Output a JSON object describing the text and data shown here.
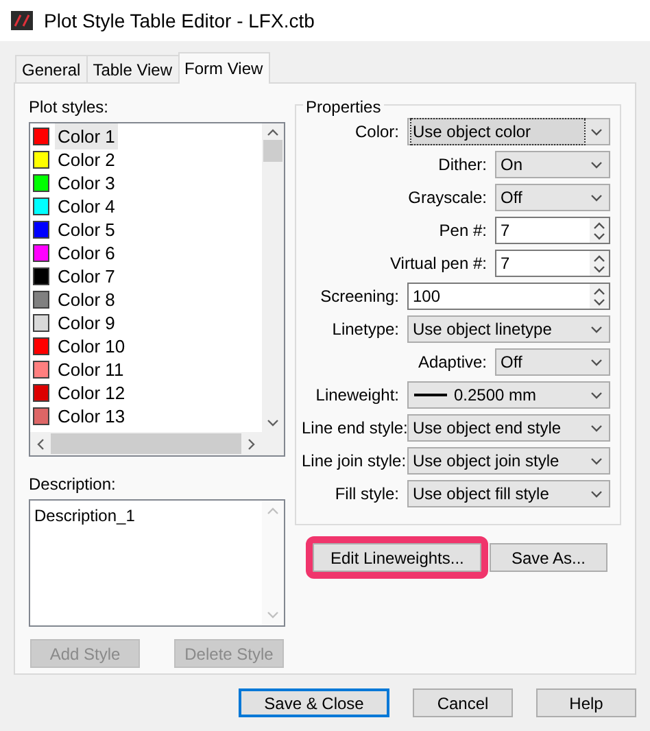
{
  "window": {
    "title": "Plot Style Table Editor - LFX.ctb"
  },
  "tabs": [
    {
      "label": "General",
      "selected": false
    },
    {
      "label": "Table View",
      "selected": false
    },
    {
      "label": "Form View",
      "selected": true
    }
  ],
  "plot_styles": {
    "label": "Plot styles:",
    "items": [
      {
        "label": "Color 1",
        "color": "#ff0000",
        "selected": true
      },
      {
        "label": "Color 2",
        "color": "#ffff00",
        "selected": false
      },
      {
        "label": "Color 3",
        "color": "#00ff00",
        "selected": false
      },
      {
        "label": "Color 4",
        "color": "#00ffff",
        "selected": false
      },
      {
        "label": "Color 5",
        "color": "#0000ff",
        "selected": false
      },
      {
        "label": "Color 6",
        "color": "#ff00ff",
        "selected": false
      },
      {
        "label": "Color 7",
        "color": "#000000",
        "selected": false
      },
      {
        "label": "Color 8",
        "color": "#808080",
        "selected": false
      },
      {
        "label": "Color 9",
        "color": "#d9d9d9",
        "selected": false
      },
      {
        "label": "Color 10",
        "color": "#ff0000",
        "selected": false
      },
      {
        "label": "Color 11",
        "color": "#ff7f7f",
        "selected": false
      },
      {
        "label": "Color 12",
        "color": "#dd0000",
        "selected": false
      },
      {
        "label": "Color 13",
        "color": "#dd6666",
        "selected": false
      }
    ]
  },
  "description": {
    "label": "Description:",
    "value": "Description_1"
  },
  "style_buttons": [
    {
      "label": "Add Style",
      "disabled": true
    },
    {
      "label": "Delete Style",
      "disabled": true
    }
  ],
  "properties": {
    "title": "Properties",
    "fields": [
      {
        "kind": "combo",
        "label": "Color:",
        "value": "Use object color",
        "focused": true
      },
      {
        "kind": "combo-narrow",
        "label": "Dither:",
        "value": "On",
        "focused": false
      },
      {
        "kind": "combo-narrow",
        "label": "Grayscale:",
        "value": "Off",
        "focused": false
      },
      {
        "kind": "spin-narrow",
        "label": "Pen #:",
        "value": "7",
        "focused": false
      },
      {
        "kind": "spin-narrow",
        "label": "Virtual pen #:",
        "value": "7",
        "focused": false
      },
      {
        "kind": "spin",
        "label": "Screening:",
        "value": "100",
        "focused": false
      },
      {
        "kind": "combo",
        "label": "Linetype:",
        "value": "Use object linetype",
        "focused": false
      },
      {
        "kind": "combo-narrow",
        "label": "Adaptive:",
        "value": "Off",
        "focused": false
      },
      {
        "kind": "lineweight",
        "label": "Lineweight:",
        "value": "0.2500 mm",
        "focused": false
      },
      {
        "kind": "combo",
        "label": "Line end style:",
        "value": "Use object end style",
        "focused": false
      },
      {
        "kind": "combo",
        "label": "Line join style:",
        "value": "Use object join style",
        "focused": false
      },
      {
        "kind": "combo",
        "label": "Fill style:",
        "value": "Use object fill style",
        "focused": false
      }
    ]
  },
  "property_buttons": [
    {
      "label": "Edit Lineweights...",
      "highlighted": true
    },
    {
      "label": "Save As...",
      "highlighted": false
    }
  ],
  "dialog_buttons": [
    {
      "label": "Save & Close",
      "default": true
    },
    {
      "label": "Cancel",
      "default": false
    },
    {
      "label": "Help",
      "default": false
    }
  ]
}
